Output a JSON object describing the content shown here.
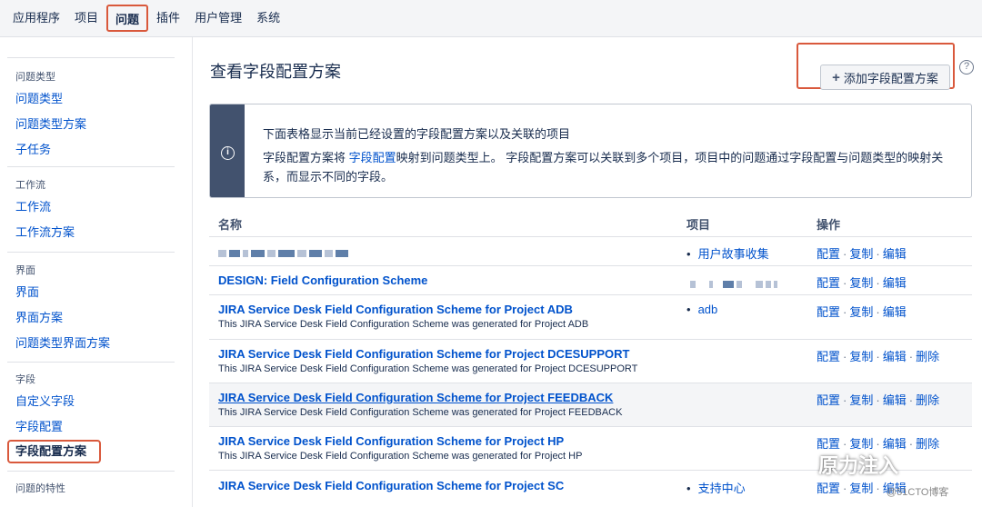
{
  "nav": {
    "tabs": [
      "应用程序",
      "项目",
      "问题",
      "插件",
      "用户管理",
      "系统"
    ],
    "active_index": 2
  },
  "sidebar": {
    "sections": [
      {
        "heading": "问题类型",
        "items": [
          "问题类型",
          "问题类型方案",
          "子任务"
        ]
      },
      {
        "heading": "工作流",
        "items": [
          "工作流",
          "工作流方案"
        ]
      },
      {
        "heading": "界面",
        "items": [
          "界面",
          "界面方案",
          "问题类型界面方案"
        ]
      },
      {
        "heading": "字段",
        "items": [
          "自定义字段",
          "字段配置",
          "字段配置方案"
        ]
      },
      {
        "heading": "问题的特性",
        "items": []
      }
    ],
    "current_item": "字段配置方案"
  },
  "page": {
    "title": "查看字段配置方案",
    "add_button": "添加字段配置方案",
    "help_icon": "question-circle-icon"
  },
  "info": {
    "line1": "下面表格显示当前已经设置的字段配置方案以及关联的项目",
    "line2_pre": "字段配置方案将 ",
    "line2_link": "字段配置",
    "line2_post": "映射到问题类型上。 字段配置方案可以关联到多个项目，项目中的问题通过字段配置与问题类型的映射关系，而显示不同的字段。"
  },
  "table": {
    "headers": [
      "名称",
      "项目",
      "操作"
    ],
    "rows": [
      {
        "name": "",
        "desc": "",
        "project": "用户故事收集",
        "ops": [
          "配置",
          "复制",
          "编辑"
        ]
      },
      {
        "name": "DESIGN: Field Configuration Scheme",
        "desc": "",
        "project": "",
        "ops": [
          "配置",
          "复制",
          "编辑"
        ]
      },
      {
        "name": "JIRA Service Desk Field Configuration Scheme for Project ADB",
        "desc": "This JIRA Service Desk Field Configuration Scheme was generated for Project ADB",
        "project": "adb",
        "ops": [
          "配置",
          "复制",
          "编辑"
        ]
      },
      {
        "name": "JIRA Service Desk Field Configuration Scheme for Project DCESUPPORT",
        "desc": "This JIRA Service Desk Field Configuration Scheme was generated for Project DCESUPPORT",
        "project": "",
        "ops": [
          "配置",
          "复制",
          "编辑",
          "删除"
        ]
      },
      {
        "name": "JIRA Service Desk Field Configuration Scheme for Project FEEDBACK",
        "desc": "This JIRA Service Desk Field Configuration Scheme was generated for Project FEEDBACK",
        "project": "",
        "ops": [
          "配置",
          "复制",
          "编辑",
          "删除"
        ]
      },
      {
        "name": "JIRA Service Desk Field Configuration Scheme for Project HP",
        "desc": "This JIRA Service Desk Field Configuration Scheme was generated for Project HP",
        "project": "",
        "ops": [
          "配置",
          "复制",
          "编辑",
          "删除"
        ]
      },
      {
        "name": "JIRA Service Desk Field Configuration Scheme for Project SC",
        "desc": "",
        "project": "支持中心",
        "ops": [
          "配置",
          "复制",
          "编辑"
        ]
      }
    ]
  },
  "watermark": {
    "main": "原力注入",
    "sub": "@51CTO博客"
  }
}
